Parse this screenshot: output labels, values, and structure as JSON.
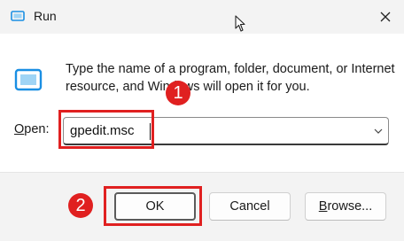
{
  "window": {
    "title": "Run",
    "icon": "run-app-icon",
    "close_icon": "close-icon"
  },
  "dialog": {
    "description": "Type the name of a program, folder, document, or Internet resource, and Windows will open it for you.",
    "open_label_prefix": "",
    "open_label_accel": "O",
    "open_label_rest": "pen:",
    "open_value": "gpedit.msc"
  },
  "buttons": {
    "ok": "OK",
    "cancel": "Cancel",
    "browse_prefix": "",
    "browse_accel": "B",
    "browse_rest": "rowse..."
  },
  "annotations": {
    "step1": "1",
    "step2": "2",
    "highlight_color": "#e02020"
  },
  "colors": {
    "accent_blue": "#1a8fe3",
    "titlebar_bg": "#f3f3f3",
    "content_bg": "#ffffff"
  }
}
